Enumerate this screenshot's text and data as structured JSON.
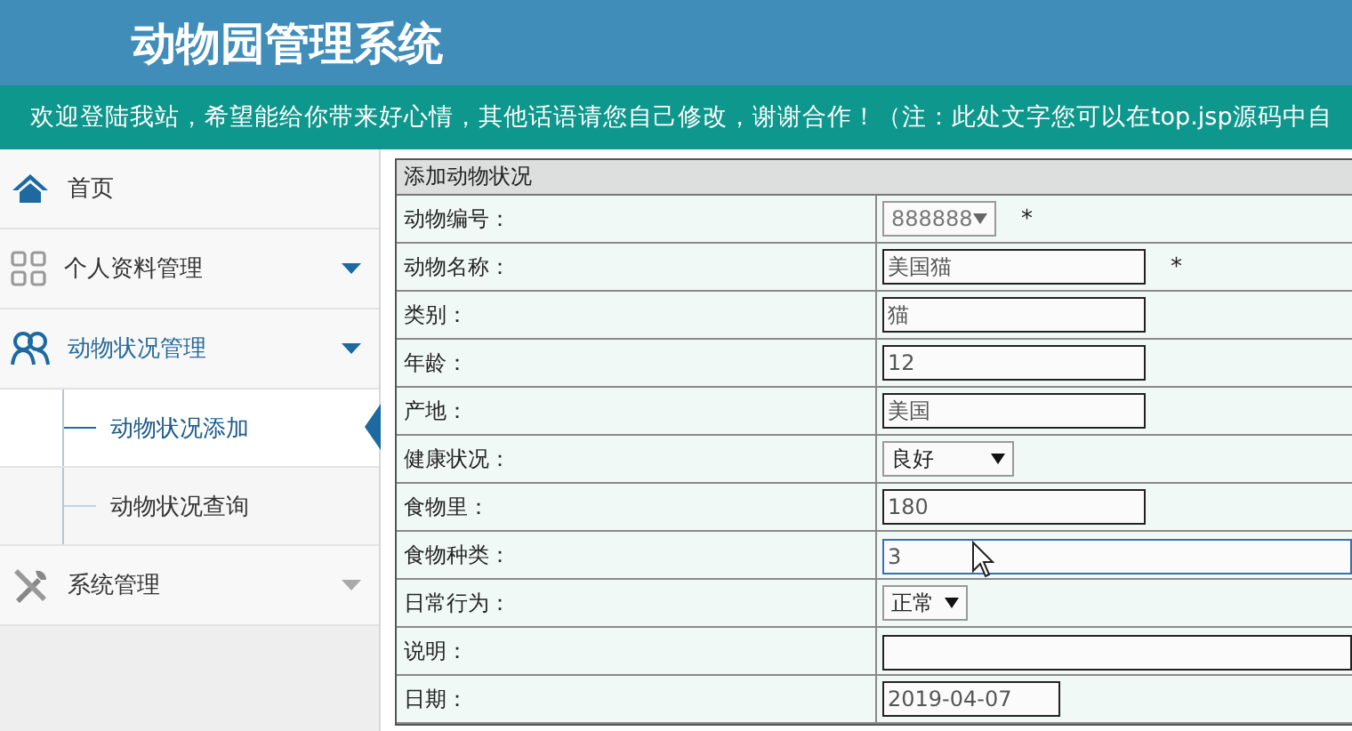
{
  "header": {
    "title": "动物园管理系统"
  },
  "notice": "欢迎登陆我站，希望能给你带来好心情，其他话语请您自己修改，谢谢合作！（注：此处文字您可以在top.jsp源码中自",
  "sidebar": {
    "items": [
      {
        "label": "首页"
      },
      {
        "label": "个人资料管理",
        "expanded": false
      },
      {
        "label": "动物状况管理",
        "expanded": true,
        "children": [
          {
            "label": "动物状况添加",
            "selected": true
          },
          {
            "label": "动物状况查询",
            "selected": false
          }
        ]
      },
      {
        "label": "系统管理",
        "expanded": false
      }
    ]
  },
  "form": {
    "title": "添加动物状况",
    "rows": [
      {
        "label": "动物编号：",
        "kind": "select",
        "value": "888888",
        "required_mark": "*"
      },
      {
        "label": "动物名称：",
        "kind": "input",
        "value": "美国猫",
        "required_mark": "*"
      },
      {
        "label": "类别：",
        "kind": "input",
        "value": "猫"
      },
      {
        "label": "年龄：",
        "kind": "input",
        "value": "12"
      },
      {
        "label": "产地：",
        "kind": "input",
        "value": "美国"
      },
      {
        "label": "健康状况：",
        "kind": "select",
        "value": "良好"
      },
      {
        "label": "食物里：",
        "kind": "input",
        "value": "180"
      },
      {
        "label": "食物种类：",
        "kind": "input",
        "value": "3",
        "focused": true
      },
      {
        "label": "日常行为：",
        "kind": "select",
        "value": "正常"
      },
      {
        "label": "说明：",
        "kind": "input",
        "value": ""
      },
      {
        "label": "日期：",
        "kind": "input",
        "value": "2019-04-07"
      }
    ]
  }
}
